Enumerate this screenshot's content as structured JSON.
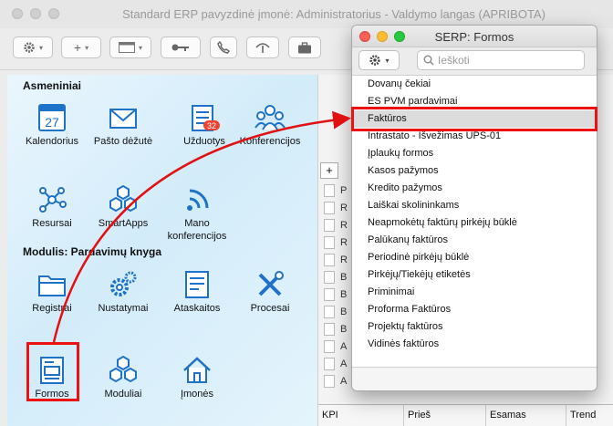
{
  "main_window": {
    "title": "Standard ERP pavyzdinė įmonė: Administratorius - Valdymo langas (APRIBOTA)",
    "toolbar_buttons": [
      {
        "name": "gear-menu-button",
        "icon": "gear-icon"
      },
      {
        "name": "add-menu-button",
        "icon": "plus-icon"
      },
      {
        "name": "window-menu-button",
        "icon": "window-icon"
      },
      {
        "name": "key-button",
        "icon": "key-icon"
      },
      {
        "name": "phone-button",
        "icon": "phone-icon"
      },
      {
        "name": "antenna-button",
        "icon": "antenna-icon"
      },
      {
        "name": "briefcase-button",
        "icon": "briefcase-icon"
      }
    ]
  },
  "personal": {
    "heading": "Asmeniniai",
    "items": [
      {
        "label": "Kalendorius",
        "icon": "calendar-icon",
        "day": "27"
      },
      {
        "label": "Pašto dėžutė",
        "icon": "mail-icon"
      },
      {
        "label": "Užduotys",
        "icon": "tasks-icon",
        "badge": "32"
      },
      {
        "label": "Konferencijos",
        "icon": "conference-icon"
      },
      {
        "label": "Resursai",
        "icon": "network-icon"
      },
      {
        "label": "SmartApps",
        "icon": "hexagons-icon"
      },
      {
        "label": "Mano konferencijos",
        "icon": "wifi-icon"
      }
    ]
  },
  "module": {
    "heading": "Modulis:  Pardavimų knyga",
    "items": [
      {
        "label": "Registrai",
        "icon": "folder-icon"
      },
      {
        "label": "Nustatymai",
        "icon": "gears-icon"
      },
      {
        "label": "Ataskaitos",
        "icon": "report-icon"
      },
      {
        "label": "Procesai",
        "icon": "tools-icon"
      },
      {
        "label": "Formos",
        "icon": "form-icon"
      },
      {
        "label": "Moduliai",
        "icon": "hexagons-icon"
      },
      {
        "label": "Įmonės",
        "icon": "house-icon"
      }
    ]
  },
  "right_pane": {
    "rows": [
      "P",
      "R",
      "R",
      "R",
      "R",
      "B",
      "B",
      "B",
      "B",
      "A",
      "A",
      "A"
    ],
    "kpi_columns": [
      "KPI",
      "Prieš",
      "Esamas",
      "Trend"
    ]
  },
  "popup": {
    "title": "SERP: Formos",
    "search_placeholder": "Ieškoti",
    "selected_index": 2,
    "items": [
      "Dovanų čekiai",
      "ES PVM pardavimai",
      "Faktūros",
      "Intrastato - Išvežimas UPS-01",
      "Įplaukų formos",
      "Kasos pažymos",
      "Kredito pažymos",
      "Laiškai skolininkams",
      "Neapmokėtų faktūrų pirkėjų būklė",
      "Palūkanų faktūros",
      "Periodinė pirkėjų būklė",
      "Pirkėjų/Tiekėjų etiketės",
      "Priminimai",
      "Proforma Faktūros",
      "Projektų faktūros",
      "Vidinės faktūros"
    ]
  },
  "colors": {
    "highlight": "#e11111",
    "close": "#fe5f57",
    "minimize": "#febc2e",
    "zoom": "#28c840",
    "icon_blue": "#1e73c8"
  }
}
